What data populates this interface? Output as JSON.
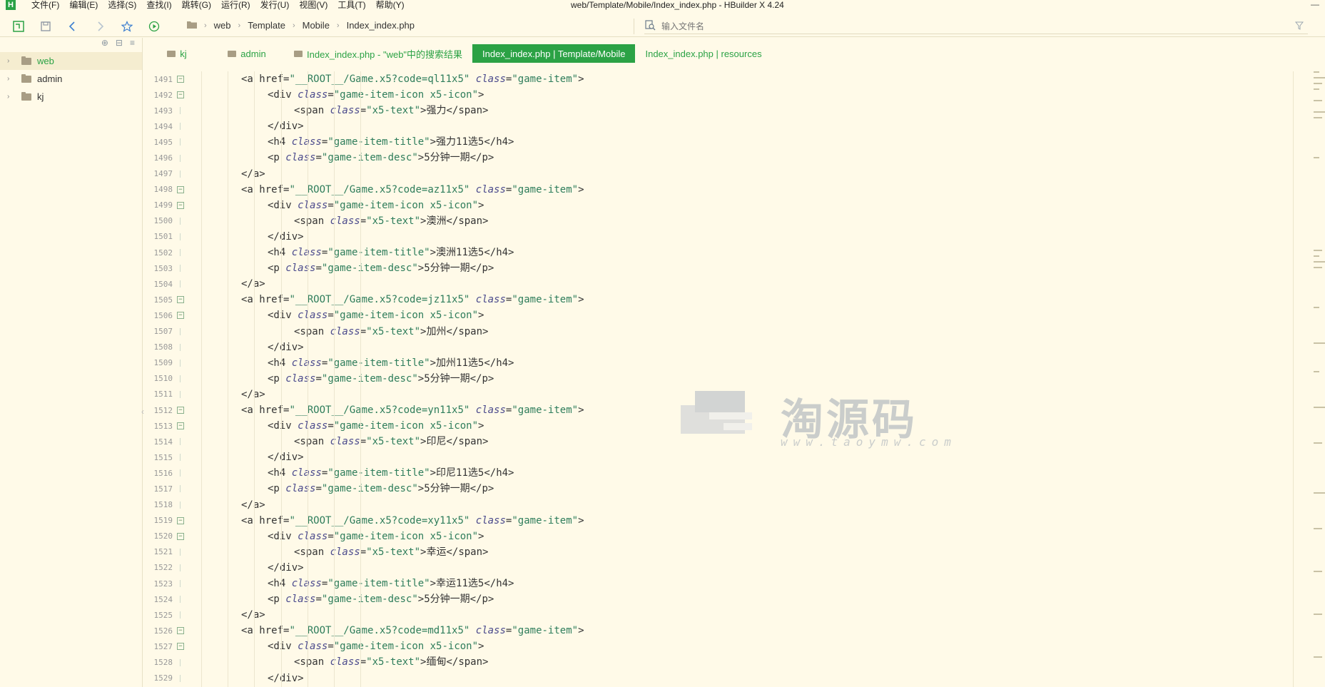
{
  "app": {
    "window_title": "web/Template/Mobile/Index_index.php - HBuilder X 4.24",
    "logo_letter": "H",
    "menu": [
      "文件(F)",
      "编辑(E)",
      "选择(S)",
      "查找(I)",
      "跳转(G)",
      "运行(R)",
      "发行(U)",
      "视图(V)",
      "工具(T)",
      "帮助(Y)"
    ],
    "minimize": "—"
  },
  "toolbar": {
    "breadcrumb": [
      "web",
      "Template",
      "Mobile",
      "Index_index.php"
    ],
    "search_placeholder": "输入文件名"
  },
  "sidebar": {
    "items": [
      {
        "label": "web",
        "active": true
      },
      {
        "label": "admin",
        "active": false
      },
      {
        "label": "kj",
        "active": false
      }
    ]
  },
  "tabs": [
    {
      "label": "kj",
      "folder": true,
      "active": false
    },
    {
      "label": "admin",
      "folder": true,
      "active": false
    },
    {
      "label": "Index_index.php - \"web\"中的搜索结果",
      "folder": true,
      "active": false
    },
    {
      "label": "Index_index.php | Template/Mobile",
      "folder": false,
      "active": true
    },
    {
      "label": "Index_index.php | resources",
      "folder": false,
      "active": false
    }
  ],
  "editor": {
    "lines": [
      {
        "n": "1491",
        "fold": true,
        "indent": 4,
        "parts": [
          [
            "tg",
            "<a "
          ],
          [
            "tg",
            "href="
          ],
          [
            "st",
            "\"__ROOT__/Game.x5?code=ql11x5\""
          ],
          [
            "tg",
            " "
          ],
          [
            "at",
            "class"
          ],
          [
            "tg",
            "="
          ],
          [
            "st",
            "\"game-item\""
          ],
          [
            "tg",
            ">"
          ]
        ]
      },
      {
        "n": "1492",
        "fold": true,
        "indent": 6,
        "parts": [
          [
            "tg",
            "<div "
          ],
          [
            "at",
            "class"
          ],
          [
            "tg",
            "="
          ],
          [
            "st",
            "\"game-item-icon x5-icon\""
          ],
          [
            "tg",
            ">"
          ]
        ]
      },
      {
        "n": "1493",
        "fold": false,
        "indent": 8,
        "parts": [
          [
            "tg",
            "<span "
          ],
          [
            "at",
            "class"
          ],
          [
            "tg",
            "="
          ],
          [
            "st",
            "\"x5-text\""
          ],
          [
            "tg",
            ">"
          ],
          [
            "tx",
            "强力"
          ],
          [
            "tg",
            "</span>"
          ]
        ]
      },
      {
        "n": "1494",
        "fold": false,
        "indent": 6,
        "parts": [
          [
            "tg",
            "</div>"
          ]
        ]
      },
      {
        "n": "1495",
        "fold": false,
        "indent": 6,
        "parts": [
          [
            "tg",
            "<h4 "
          ],
          [
            "at",
            "class"
          ],
          [
            "tg",
            "="
          ],
          [
            "st",
            "\"game-item-title\""
          ],
          [
            "tg",
            ">"
          ],
          [
            "tx",
            "强力11选5"
          ],
          [
            "tg",
            "</h4>"
          ]
        ]
      },
      {
        "n": "1496",
        "fold": false,
        "indent": 6,
        "parts": [
          [
            "tg",
            "<p "
          ],
          [
            "at",
            "class"
          ],
          [
            "tg",
            "="
          ],
          [
            "st",
            "\"game-item-desc\""
          ],
          [
            "tg",
            ">"
          ],
          [
            "tx",
            "5分钟一期"
          ],
          [
            "tg",
            "</p>"
          ]
        ]
      },
      {
        "n": "1497",
        "fold": false,
        "indent": 4,
        "parts": [
          [
            "tg",
            "</a>"
          ]
        ]
      },
      {
        "n": "1498",
        "fold": true,
        "indent": 4,
        "parts": [
          [
            "tg",
            "<a "
          ],
          [
            "tg",
            "href="
          ],
          [
            "st",
            "\"__ROOT__/Game.x5?code=az11x5\""
          ],
          [
            "tg",
            " "
          ],
          [
            "at",
            "class"
          ],
          [
            "tg",
            "="
          ],
          [
            "st",
            "\"game-item\""
          ],
          [
            "tg",
            ">"
          ]
        ]
      },
      {
        "n": "1499",
        "fold": true,
        "indent": 6,
        "parts": [
          [
            "tg",
            "<div "
          ],
          [
            "at",
            "class"
          ],
          [
            "tg",
            "="
          ],
          [
            "st",
            "\"game-item-icon x5-icon\""
          ],
          [
            "tg",
            ">"
          ]
        ]
      },
      {
        "n": "1500",
        "fold": false,
        "indent": 8,
        "parts": [
          [
            "tg",
            "<span "
          ],
          [
            "at",
            "class"
          ],
          [
            "tg",
            "="
          ],
          [
            "st",
            "\"x5-text\""
          ],
          [
            "tg",
            ">"
          ],
          [
            "tx",
            "澳洲"
          ],
          [
            "tg",
            "</span>"
          ]
        ]
      },
      {
        "n": "1501",
        "fold": false,
        "indent": 6,
        "parts": [
          [
            "tg",
            "</div>"
          ]
        ]
      },
      {
        "n": "1502",
        "fold": false,
        "indent": 6,
        "parts": [
          [
            "tg",
            "<h4 "
          ],
          [
            "at",
            "class"
          ],
          [
            "tg",
            "="
          ],
          [
            "st",
            "\"game-item-title\""
          ],
          [
            "tg",
            ">"
          ],
          [
            "tx",
            "澳洲11选5"
          ],
          [
            "tg",
            "</h4>"
          ]
        ]
      },
      {
        "n": "1503",
        "fold": false,
        "indent": 6,
        "parts": [
          [
            "tg",
            "<p "
          ],
          [
            "at",
            "class"
          ],
          [
            "tg",
            "="
          ],
          [
            "st",
            "\"game-item-desc\""
          ],
          [
            "tg",
            ">"
          ],
          [
            "tx",
            "5分钟一期"
          ],
          [
            "tg",
            "</p>"
          ]
        ]
      },
      {
        "n": "1504",
        "fold": false,
        "indent": 4,
        "parts": [
          [
            "tg",
            "</a>"
          ]
        ]
      },
      {
        "n": "1505",
        "fold": true,
        "indent": 4,
        "parts": [
          [
            "tg",
            "<a "
          ],
          [
            "tg",
            "href="
          ],
          [
            "st",
            "\"__ROOT__/Game.x5?code=jz11x5\""
          ],
          [
            "tg",
            " "
          ],
          [
            "at",
            "class"
          ],
          [
            "tg",
            "="
          ],
          [
            "st",
            "\"game-item\""
          ],
          [
            "tg",
            ">"
          ]
        ]
      },
      {
        "n": "1506",
        "fold": true,
        "indent": 6,
        "parts": [
          [
            "tg",
            "<div "
          ],
          [
            "at",
            "class"
          ],
          [
            "tg",
            "="
          ],
          [
            "st",
            "\"game-item-icon x5-icon\""
          ],
          [
            "tg",
            ">"
          ]
        ]
      },
      {
        "n": "1507",
        "fold": false,
        "indent": 8,
        "parts": [
          [
            "tg",
            "<span "
          ],
          [
            "at",
            "class"
          ],
          [
            "tg",
            "="
          ],
          [
            "st",
            "\"x5-text\""
          ],
          [
            "tg",
            ">"
          ],
          [
            "tx",
            "加州"
          ],
          [
            "tg",
            "</span>"
          ]
        ]
      },
      {
        "n": "1508",
        "fold": false,
        "indent": 6,
        "parts": [
          [
            "tg",
            "</div>"
          ]
        ]
      },
      {
        "n": "1509",
        "fold": false,
        "indent": 6,
        "parts": [
          [
            "tg",
            "<h4 "
          ],
          [
            "at",
            "class"
          ],
          [
            "tg",
            "="
          ],
          [
            "st",
            "\"game-item-title\""
          ],
          [
            "tg",
            ">"
          ],
          [
            "tx",
            "加州11选5"
          ],
          [
            "tg",
            "</h4>"
          ]
        ]
      },
      {
        "n": "1510",
        "fold": false,
        "indent": 6,
        "parts": [
          [
            "tg",
            "<p "
          ],
          [
            "at",
            "class"
          ],
          [
            "tg",
            "="
          ],
          [
            "st",
            "\"game-item-desc\""
          ],
          [
            "tg",
            ">"
          ],
          [
            "tx",
            "5分钟一期"
          ],
          [
            "tg",
            "</p>"
          ]
        ]
      },
      {
        "n": "1511",
        "fold": false,
        "indent": 4,
        "parts": [
          [
            "tg",
            "</a>"
          ]
        ]
      },
      {
        "n": "1512",
        "fold": true,
        "indent": 4,
        "parts": [
          [
            "tg",
            "<a "
          ],
          [
            "tg",
            "href="
          ],
          [
            "st",
            "\"__ROOT__/Game.x5?code=yn11x5\""
          ],
          [
            "tg",
            " "
          ],
          [
            "at",
            "class"
          ],
          [
            "tg",
            "="
          ],
          [
            "st",
            "\"game-item\""
          ],
          [
            "tg",
            ">"
          ]
        ]
      },
      {
        "n": "1513",
        "fold": true,
        "indent": 6,
        "parts": [
          [
            "tg",
            "<div "
          ],
          [
            "at",
            "class"
          ],
          [
            "tg",
            "="
          ],
          [
            "st",
            "\"game-item-icon x5-icon\""
          ],
          [
            "tg",
            ">"
          ]
        ]
      },
      {
        "n": "1514",
        "fold": false,
        "indent": 8,
        "parts": [
          [
            "tg",
            "<span "
          ],
          [
            "at",
            "class"
          ],
          [
            "tg",
            "="
          ],
          [
            "st",
            "\"x5-text\""
          ],
          [
            "tg",
            ">"
          ],
          [
            "tx",
            "印尼"
          ],
          [
            "tg",
            "</span>"
          ]
        ]
      },
      {
        "n": "1515",
        "fold": false,
        "indent": 6,
        "parts": [
          [
            "tg",
            "</div>"
          ]
        ]
      },
      {
        "n": "1516",
        "fold": false,
        "indent": 6,
        "parts": [
          [
            "tg",
            "<h4 "
          ],
          [
            "at",
            "class"
          ],
          [
            "tg",
            "="
          ],
          [
            "st",
            "\"game-item-title\""
          ],
          [
            "tg",
            ">"
          ],
          [
            "tx",
            "印尼11选5"
          ],
          [
            "tg",
            "</h4>"
          ]
        ]
      },
      {
        "n": "1517",
        "fold": false,
        "indent": 6,
        "parts": [
          [
            "tg",
            "<p "
          ],
          [
            "at",
            "class"
          ],
          [
            "tg",
            "="
          ],
          [
            "st",
            "\"game-item-desc\""
          ],
          [
            "tg",
            ">"
          ],
          [
            "tx",
            "5分钟一期"
          ],
          [
            "tg",
            "</p>"
          ]
        ]
      },
      {
        "n": "1518",
        "fold": false,
        "indent": 4,
        "parts": [
          [
            "tg",
            "</a>"
          ]
        ]
      },
      {
        "n": "1519",
        "fold": true,
        "indent": 4,
        "parts": [
          [
            "tg",
            "<a "
          ],
          [
            "tg",
            "href="
          ],
          [
            "st",
            "\"__ROOT__/Game.x5?code=xy11x5\""
          ],
          [
            "tg",
            " "
          ],
          [
            "at",
            "class"
          ],
          [
            "tg",
            "="
          ],
          [
            "st",
            "\"game-item\""
          ],
          [
            "tg",
            ">"
          ]
        ]
      },
      {
        "n": "1520",
        "fold": true,
        "indent": 6,
        "parts": [
          [
            "tg",
            "<div "
          ],
          [
            "at",
            "class"
          ],
          [
            "tg",
            "="
          ],
          [
            "st",
            "\"game-item-icon x5-icon\""
          ],
          [
            "tg",
            ">"
          ]
        ]
      },
      {
        "n": "1521",
        "fold": false,
        "indent": 8,
        "parts": [
          [
            "tg",
            "<span "
          ],
          [
            "at",
            "class"
          ],
          [
            "tg",
            "="
          ],
          [
            "st",
            "\"x5-text\""
          ],
          [
            "tg",
            ">"
          ],
          [
            "tx",
            "幸运"
          ],
          [
            "tg",
            "</span>"
          ]
        ]
      },
      {
        "n": "1522",
        "fold": false,
        "indent": 6,
        "parts": [
          [
            "tg",
            "</div>"
          ]
        ]
      },
      {
        "n": "1523",
        "fold": false,
        "indent": 6,
        "parts": [
          [
            "tg",
            "<h4 "
          ],
          [
            "at",
            "class"
          ],
          [
            "tg",
            "="
          ],
          [
            "st",
            "\"game-item-title\""
          ],
          [
            "tg",
            ">"
          ],
          [
            "tx",
            "幸运11选5"
          ],
          [
            "tg",
            "</h4>"
          ]
        ]
      },
      {
        "n": "1524",
        "fold": false,
        "indent": 6,
        "parts": [
          [
            "tg",
            "<p "
          ],
          [
            "at",
            "class"
          ],
          [
            "tg",
            "="
          ],
          [
            "st",
            "\"game-item-desc\""
          ],
          [
            "tg",
            ">"
          ],
          [
            "tx",
            "5分钟一期"
          ],
          [
            "tg",
            "</p>"
          ]
        ]
      },
      {
        "n": "1525",
        "fold": false,
        "indent": 4,
        "parts": [
          [
            "tg",
            "</a>"
          ]
        ]
      },
      {
        "n": "1526",
        "fold": true,
        "indent": 4,
        "parts": [
          [
            "tg",
            "<a "
          ],
          [
            "tg",
            "href="
          ],
          [
            "st",
            "\"__ROOT__/Game.x5?code=md11x5\""
          ],
          [
            "tg",
            " "
          ],
          [
            "at",
            "class"
          ],
          [
            "tg",
            "="
          ],
          [
            "st",
            "\"game-item\""
          ],
          [
            "tg",
            ">"
          ]
        ]
      },
      {
        "n": "1527",
        "fold": true,
        "indent": 6,
        "parts": [
          [
            "tg",
            "<div "
          ],
          [
            "at",
            "class"
          ],
          [
            "tg",
            "="
          ],
          [
            "st",
            "\"game-item-icon x5-icon\""
          ],
          [
            "tg",
            ">"
          ]
        ]
      },
      {
        "n": "1528",
        "fold": false,
        "indent": 8,
        "parts": [
          [
            "tg",
            "<span "
          ],
          [
            "at",
            "class"
          ],
          [
            "tg",
            "="
          ],
          [
            "st",
            "\"x5-text\""
          ],
          [
            "tg",
            ">"
          ],
          [
            "tx",
            "缅甸"
          ],
          [
            "tg",
            "</span>"
          ]
        ]
      },
      {
        "n": "1529",
        "fold": false,
        "indent": 6,
        "parts": [
          [
            "tg",
            "</div>"
          ]
        ]
      }
    ]
  },
  "watermark": {
    "title": "淘源码",
    "url": "www.taoymw.com"
  }
}
